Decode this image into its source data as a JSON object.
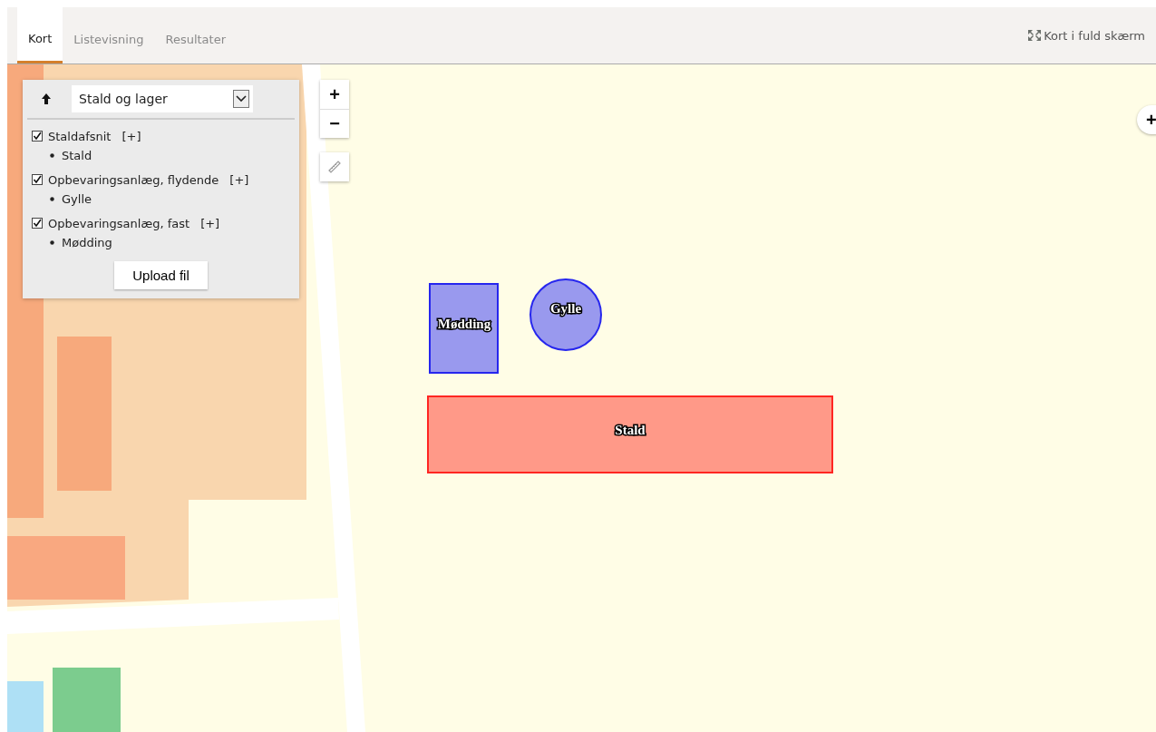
{
  "tabs": [
    {
      "label": "Kort",
      "selected": true
    },
    {
      "label": "Listevisning",
      "selected": false
    },
    {
      "label": "Resultater",
      "selected": false
    }
  ],
  "fullscreen_link": {
    "label": "Kort i fuld skærm"
  },
  "layer_panel": {
    "dropdown": {
      "value": "Stald og lager"
    },
    "layers": [
      {
        "label": "Staldafsnit",
        "expand": "[+]",
        "checked": true,
        "items": [
          "Stald"
        ]
      },
      {
        "label": "Opbevaringsanlæg, flydende",
        "expand": "[+]",
        "checked": true,
        "items": [
          "Gylle"
        ]
      },
      {
        "label": "Opbevaringsanlæg, fast",
        "expand": "[+]",
        "checked": true,
        "items": [
          "Mødding"
        ]
      }
    ],
    "upload_button": "Upload fil"
  },
  "map_controls": {
    "zoom_in": "+",
    "zoom_out": "−",
    "side_button": "+"
  },
  "features": [
    {
      "label": "Mødding",
      "kind": "rect",
      "color": "#9999ee"
    },
    {
      "label": "Gylle",
      "kind": "circle",
      "color": "#9999ee"
    },
    {
      "label": "Stald",
      "kind": "rect",
      "color": "#ff9988"
    }
  ]
}
